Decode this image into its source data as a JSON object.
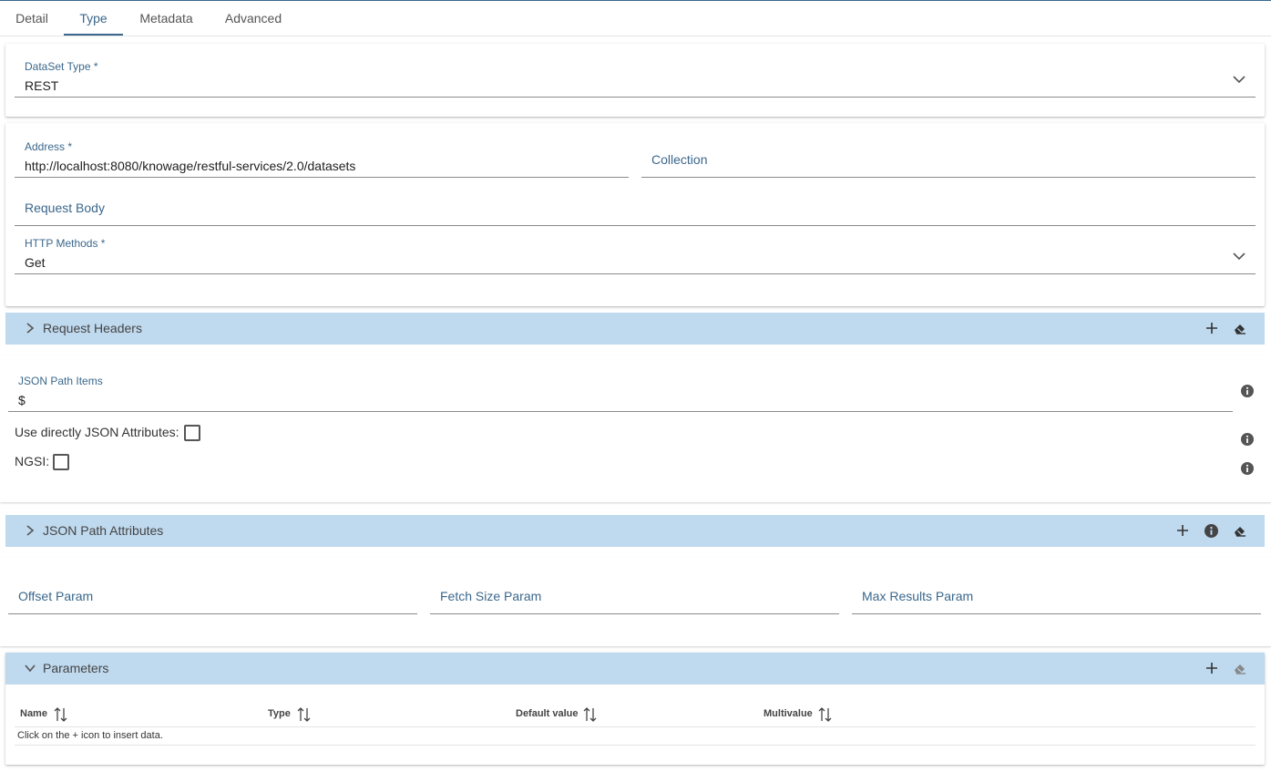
{
  "tabs": [
    {
      "label": "Detail"
    },
    {
      "label": "Type"
    },
    {
      "label": "Metadata"
    },
    {
      "label": "Advanced"
    }
  ],
  "active_tab": "Type",
  "dataset_type": {
    "label": "DataSet Type *",
    "value": "REST"
  },
  "address": {
    "label": "Address *",
    "value": "http://localhost:8080/knowage/restful-services/2.0/datasets"
  },
  "collection": {
    "placeholder": "Collection"
  },
  "request_body": {
    "placeholder": "Request Body"
  },
  "http_methods": {
    "label": "HTTP Methods *",
    "value": "Get"
  },
  "request_headers": {
    "title": "Request Headers"
  },
  "json_path_items": {
    "label": "JSON Path Items",
    "value": "$"
  },
  "use_json_attributes": {
    "label": "Use directly JSON Attributes:",
    "checked": false
  },
  "ngsi": {
    "label": "NGSI:",
    "checked": false
  },
  "json_path_attributes": {
    "title": "JSON Path Attributes"
  },
  "offset_param": {
    "placeholder": "Offset Param"
  },
  "fetch_size_param": {
    "placeholder": "Fetch Size Param"
  },
  "max_results_param": {
    "placeholder": "Max Results Param"
  },
  "parameters": {
    "title": "Parameters",
    "columns": [
      "Name",
      "Type",
      "Default value",
      "Multivalue"
    ],
    "empty_message": "Click on the + icon to insert data."
  },
  "colors": {
    "accent": "#3b678c",
    "toolbar": "#bfd9ee"
  }
}
